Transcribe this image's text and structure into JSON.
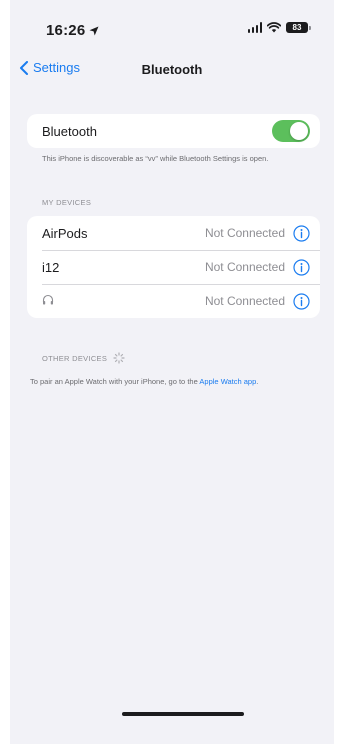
{
  "status_bar": {
    "time": "16:26",
    "battery": "83"
  },
  "nav": {
    "back_label": "Settings",
    "title": "Bluetooth"
  },
  "bluetooth": {
    "label": "Bluetooth",
    "enabled": true,
    "discoverable_note": "This iPhone is discoverable as “vv” while Bluetooth Settings is open."
  },
  "my_devices": {
    "header": "MY DEVICES",
    "items": [
      {
        "name": "AirPods",
        "status": "Not Connected"
      },
      {
        "name": "i12",
        "status": "Not Connected"
      },
      {
        "name": "",
        "status": "Not Connected",
        "icon": "headphones-icon"
      }
    ]
  },
  "other_devices": {
    "header": "OTHER DEVICES",
    "note_prefix": "To pair an Apple Watch with your iPhone, go to the ",
    "note_link": "Apple Watch app",
    "note_suffix": "."
  },
  "colors": {
    "accent": "#1a7cf0",
    "toggle_on": "#5cbf5c",
    "background": "#f2f2f7"
  }
}
